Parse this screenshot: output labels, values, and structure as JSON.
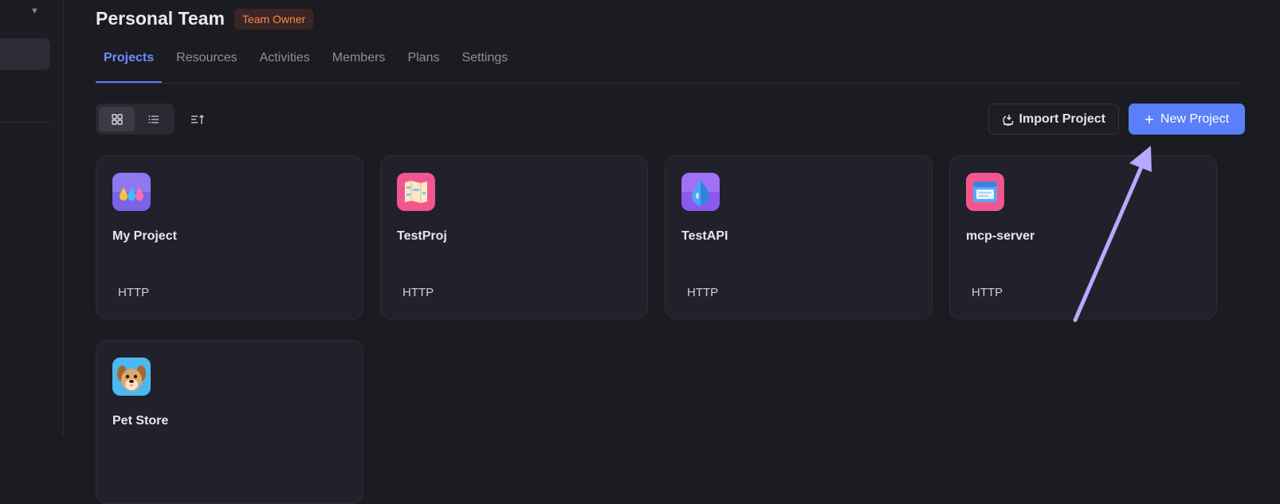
{
  "header": {
    "title": "Personal Team",
    "badge": "Team Owner"
  },
  "tabs": [
    {
      "label": "Projects",
      "active": true
    },
    {
      "label": "Resources"
    },
    {
      "label": "Activities"
    },
    {
      "label": "Members"
    },
    {
      "label": "Plans"
    },
    {
      "label": "Settings"
    }
  ],
  "toolbar": {
    "grid_view_icon": "grid-icon",
    "list_view_icon": "list-icon",
    "sort_icon": "sort-icon",
    "import_label": "Import Project",
    "new_label": "New Project"
  },
  "projects": [
    {
      "name": "My Project",
      "type": "HTTP",
      "icon": "droplets-icon"
    },
    {
      "name": "TestProj",
      "type": "HTTP",
      "icon": "map-icon"
    },
    {
      "name": "TestAPI",
      "type": "HTTP",
      "icon": "water-drop-icon"
    },
    {
      "name": "mcp-server",
      "type": "HTTP",
      "icon": "server-icon"
    },
    {
      "name": "Pet Store",
      "type": "",
      "icon": "dog-icon"
    }
  ],
  "colors": {
    "accent": "#5a7ff8",
    "badge_text": "#f3884f",
    "annotation_arrow": "#b7a9ff"
  }
}
